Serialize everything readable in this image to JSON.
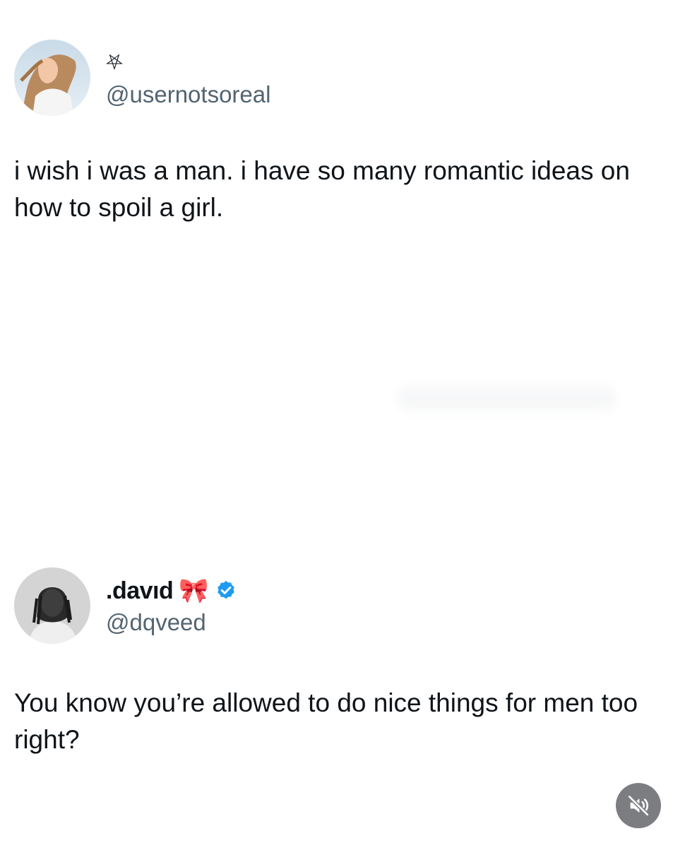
{
  "posts": [
    {
      "display_name": "",
      "display_symbol": "⛧",
      "handle": "@usernotsoreal",
      "verified": false,
      "text": "i wish i was a man. i have so many romantic ideas on how to spoil a girl."
    },
    {
      "display_name": ".davıd",
      "display_symbol": "🎀",
      "handle": "@dqveed",
      "verified": true,
      "text": "You know you’re allowed to do nice things for men too right?"
    }
  ],
  "colors": {
    "handle": "#536471",
    "verified": "#1d9bf0",
    "mute_button": "#7b7d81"
  },
  "icons": {
    "verified": "verified-badge-icon",
    "mute": "speaker-muted-icon"
  }
}
